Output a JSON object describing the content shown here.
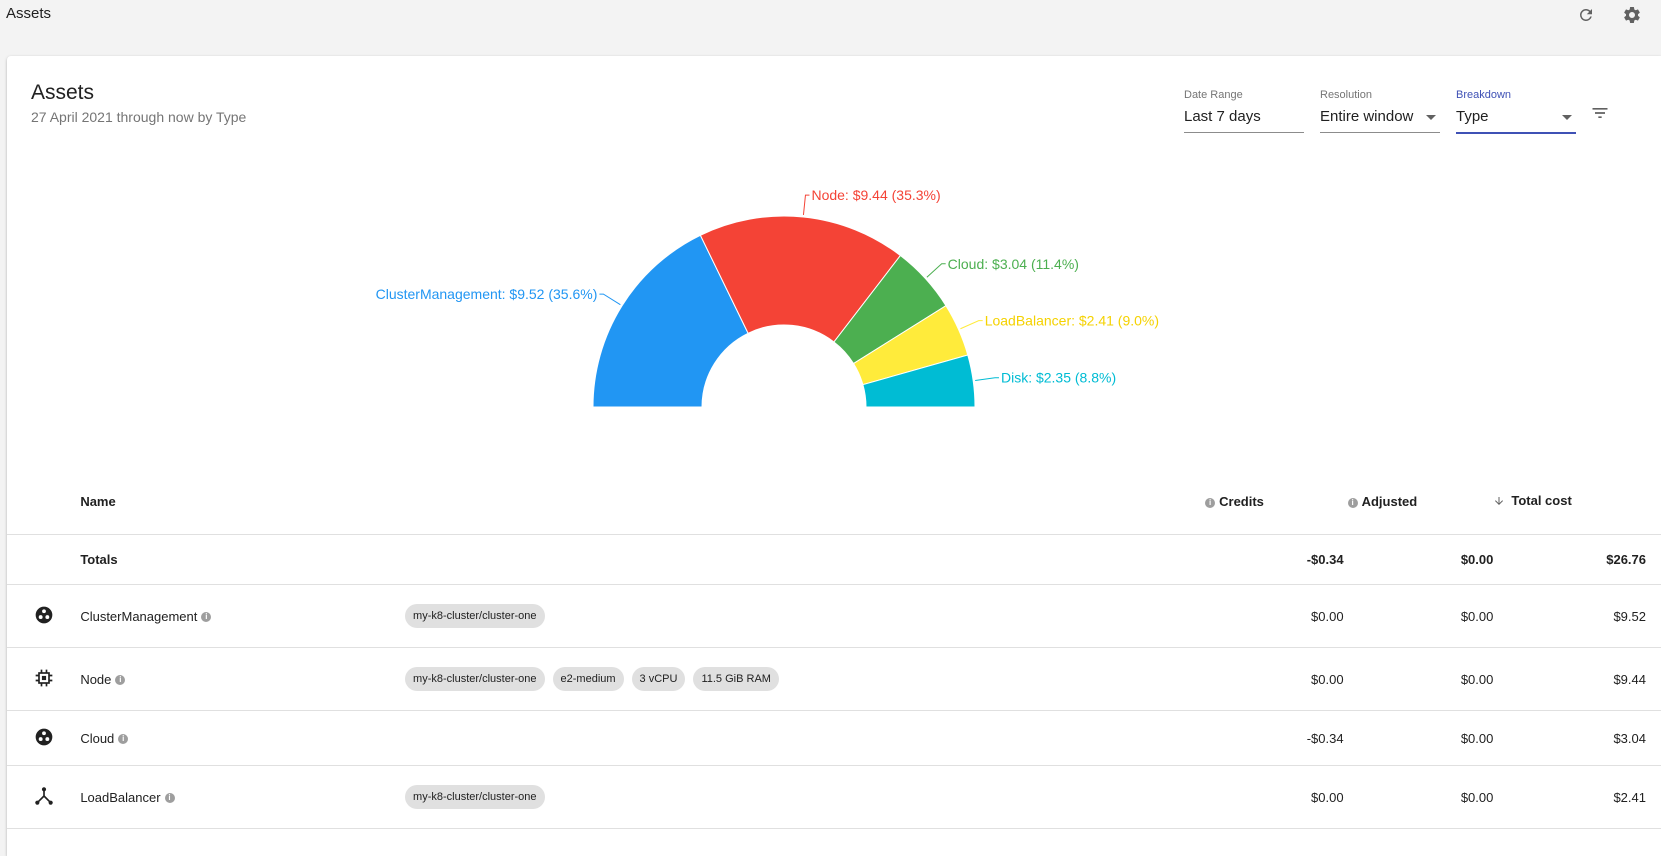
{
  "app_title": "Assets",
  "toolbar": {
    "refresh_icon": "refresh-icon",
    "settings_icon": "gear-icon"
  },
  "card": {
    "title": "Assets",
    "subtitle": "27 April 2021 through now by Type"
  },
  "controls": {
    "date_range": {
      "label": "Date Range",
      "value": "Last 7 days"
    },
    "resolution": {
      "label": "Resolution",
      "value": "Entire window"
    },
    "breakdown": {
      "label": "Breakdown",
      "value": "Type"
    },
    "filter_icon": "filter-icon"
  },
  "chart_data": {
    "type": "pie",
    "variant": "half-donut",
    "slices": [
      {
        "name": "ClusterManagement",
        "value": 9.52,
        "percent": 35.6,
        "label": "ClusterManagement: $9.52 (35.6%)",
        "color": "#2196f3"
      },
      {
        "name": "Node",
        "value": 9.44,
        "percent": 35.3,
        "label": "Node: $9.44 (35.3%)",
        "color": "#f44336"
      },
      {
        "name": "Cloud",
        "value": 3.04,
        "percent": 11.4,
        "label": "Cloud: $3.04 (11.4%)",
        "color": "#4caf50"
      },
      {
        "name": "LoadBalancer",
        "value": 2.41,
        "percent": 9.0,
        "label": "LoadBalancer: $2.41 (9.0%)",
        "color": "#ffeb3b"
      },
      {
        "name": "Disk",
        "value": 2.35,
        "percent": 8.8,
        "label": "Disk: $2.35 (8.8%)",
        "color": "#00bcd4"
      }
    ]
  },
  "table": {
    "headers": {
      "name": "Name",
      "credits": "Credits",
      "adjusted": "Adjusted",
      "total": "Total cost"
    },
    "totals": {
      "name": "Totals",
      "credits": "-$0.34",
      "adjusted": "$0.00",
      "total": "$26.76"
    },
    "rows": [
      {
        "icon": "cluster-icon",
        "name": "ClusterManagement",
        "tags": [
          "my-k8-cluster/cluster-one"
        ],
        "credits": "$0.00",
        "adjusted": "$0.00",
        "total": "$9.52"
      },
      {
        "icon": "chip-icon",
        "name": "Node",
        "tags": [
          "my-k8-cluster/cluster-one",
          "e2-medium",
          "3 vCPU",
          "11.5 GiB RAM"
        ],
        "credits": "$0.00",
        "adjusted": "$0.00",
        "total": "$9.44"
      },
      {
        "icon": "cluster-icon",
        "name": "Cloud",
        "tags": [],
        "credits": "-$0.34",
        "adjusted": "$0.00",
        "total": "$3.04"
      },
      {
        "icon": "load-balancer-icon",
        "name": "LoadBalancer",
        "tags": [
          "my-k8-cluster/cluster-one"
        ],
        "credits": "$0.00",
        "adjusted": "$0.00",
        "total": "$2.41"
      }
    ]
  }
}
